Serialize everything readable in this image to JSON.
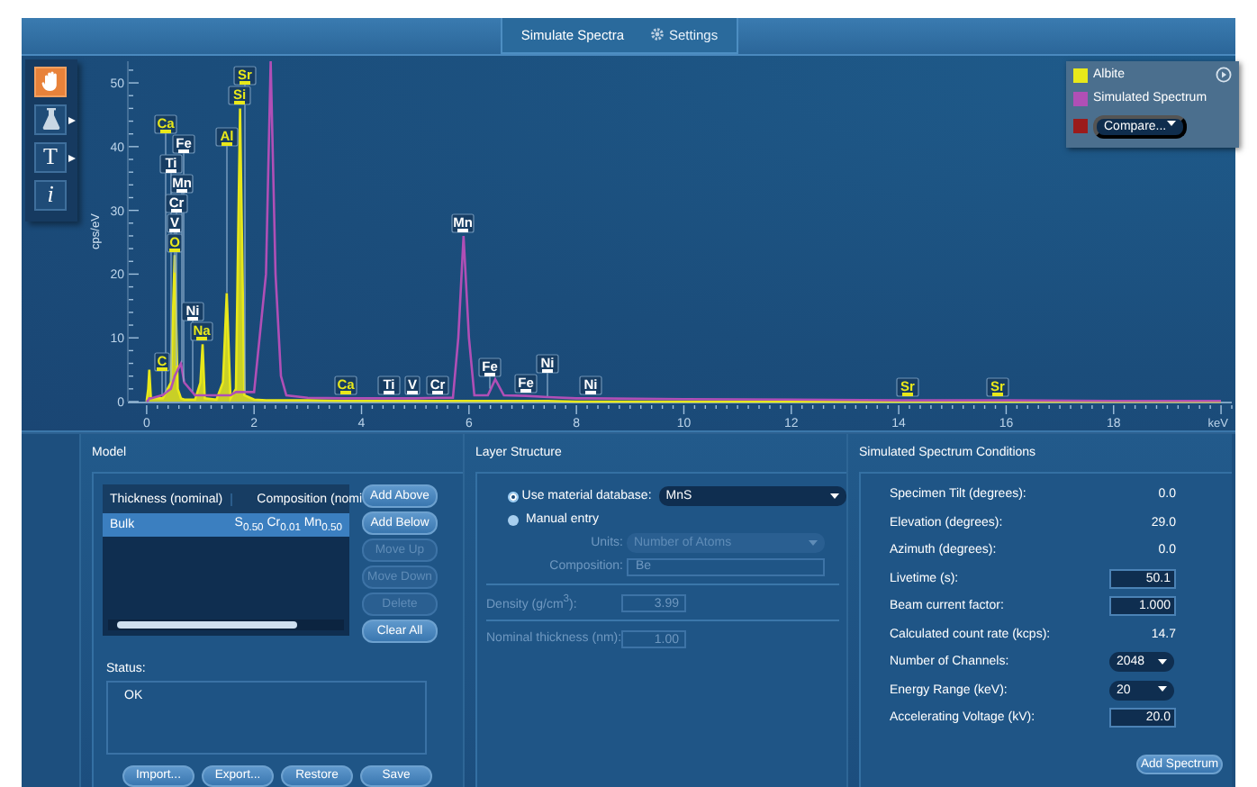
{
  "tabs": [
    {
      "label": "Simulate Spectra",
      "selected": true
    },
    {
      "label": "Settings",
      "selected": false
    }
  ],
  "toolbar": [
    {
      "kind": "hand",
      "selected": true,
      "menu": false
    },
    {
      "kind": "flask",
      "selected": false,
      "menu": true
    },
    {
      "kind": "glyph",
      "label": "T",
      "selected": false,
      "menu": true
    },
    {
      "kind": "glyph",
      "label": "i",
      "selected": false,
      "menu": false
    }
  ],
  "compare": {
    "label": "Compare...",
    "color": "#9b1b1b"
  },
  "chart_data": {
    "type": "line",
    "xlabel": "keV",
    "ylabel": "cps/eV",
    "xlim": [
      -0.35,
      20.2
    ],
    "ylim": [
      0,
      53.4
    ],
    "xticks": [
      0,
      2,
      4,
      6,
      8,
      10,
      12,
      14,
      16,
      18
    ],
    "yticks": [
      0,
      10,
      20,
      30,
      40,
      50
    ],
    "legend": "upper right",
    "x": [
      0,
      0.03,
      0.05,
      0.08,
      0.28,
      0.3,
      0.34,
      0.45,
      0.51,
      0.52,
      0.57,
      0.58,
      0.64,
      0.7,
      0.85,
      0.9,
      1.0,
      1.04,
      1.08,
      1.3,
      1.42,
      1.49,
      1.56,
      1.66,
      1.74,
      1.82,
      2.0,
      2.22,
      2.31,
      2.4,
      2.5,
      2.6,
      3,
      3.69,
      4,
      4.51,
      4.95,
      5,
      5.41,
      5.7,
      5.8,
      5.9,
      6.0,
      6.1,
      6.35,
      6.4,
      6.49,
      6.65,
      7.06,
      7.47,
      8,
      8.26,
      10,
      12,
      14,
      14.16,
      15.84,
      16,
      18,
      20
    ],
    "series": [
      {
        "name": "Albite",
        "color": "#e8e81a",
        "values": [
          0,
          2,
          5,
          0.5,
          0.5,
          0.5,
          1.2,
          3,
          20.1,
          23,
          5.5,
          2,
          0.5,
          0.3,
          0.3,
          0.3,
          3,
          9,
          0.5,
          0.3,
          3,
          17,
          0.5,
          2,
          46,
          1,
          0.3,
          0.2,
          0.2,
          0.2,
          0.2,
          0.2,
          0.2,
          0.1,
          0.1,
          0.1,
          0.1,
          0.1,
          0.1,
          0.1,
          0.1,
          0.1,
          0.1,
          0.1,
          0.1,
          0.1,
          0.1,
          0.1,
          0.1,
          0.1,
          0,
          0,
          0,
          0,
          0,
          0,
          0,
          0,
          0,
          0
        ]
      },
      {
        "name": "Simulated Spectrum",
        "color": "#b04fb6",
        "values": [
          0,
          0.2,
          0.5,
          0.5,
          1,
          1,
          1.3,
          2,
          3.7,
          4,
          4.8,
          5,
          6,
          3,
          1.5,
          1,
          1,
          1,
          1,
          1,
          1,
          1,
          1,
          1.5,
          1.5,
          1.5,
          1.5,
          20,
          53.4,
          20,
          4,
          1,
          0.6,
          0.5,
          0.5,
          0.5,
          0.5,
          0.5,
          0.6,
          0.6,
          10,
          26,
          10,
          1,
          1,
          1.9,
          3.5,
          1,
          0.9,
          0.7,
          0.5,
          0.5,
          0.4,
          0.3,
          0.2,
          0.2,
          0.2,
          0.2,
          0.1,
          0.1
        ]
      }
    ],
    "annotations": [
      {
        "text": "Si",
        "x": 1.74,
        "y": 46
      },
      {
        "text": "O",
        "x": 0.52,
        "y": 23
      },
      {
        "text": "V",
        "x": 0.51,
        "y": 20.1
      },
      {
        "text": "Al",
        "x": 1.49,
        "y": 17
      },
      {
        "text": "Na",
        "x": 1.04,
        "y": 9
      },
      {
        "text": "Cr",
        "x": 0.57,
        "y": 5.5
      },
      {
        "text": "Mn",
        "x": 0.64,
        "y": 6
      },
      {
        "text": "Ti",
        "x": 0.45,
        "y": 3
      },
      {
        "text": "Sr",
        "x": 1.82,
        "y": 1.5
      },
      {
        "text": "C",
        "x": 0.28,
        "y": 1
      },
      {
        "text": "Fe",
        "x": 0.7,
        "y": 3
      },
      {
        "text": "Ca",
        "x": 0.34,
        "y": 1.3
      },
      {
        "text": "Ni",
        "x": 0.85,
        "y": 1.5
      },
      {
        "text": "Ca",
        "x": 3.69,
        "y": 0.5
      },
      {
        "text": "Ti",
        "x": 4.51,
        "y": 0.5
      },
      {
        "text": "V",
        "x": 4.95,
        "y": 0.5
      },
      {
        "text": "Cr",
        "x": 5.41,
        "y": 0.6
      },
      {
        "text": "Mn",
        "x": 5.9,
        "y": 26
      },
      {
        "text": "Fe",
        "x": 6.4,
        "y": 1.9
      },
      {
        "text": "Fe",
        "x": 7.06,
        "y": 0.9
      },
      {
        "text": "Ni",
        "x": 7.47,
        "y": 0.7
      },
      {
        "text": "Ni",
        "x": 8.26,
        "y": 0.5
      },
      {
        "text": "Sr",
        "x": 14.16,
        "y": 0.2
      },
      {
        "text": "Sr",
        "x": 15.84,
        "y": 0.2
      }
    ]
  },
  "peak_markers": [
    {
      "color": "#e8e81a"
    },
    {
      "color": "#e8e81a"
    },
    {
      "color": "#ffffff"
    },
    {
      "color": "#e8e81a"
    },
    {
      "color": "#e8e81a"
    },
    {
      "color": "#ffffff"
    },
    {
      "color": "#ffffff"
    },
    {
      "color": "#ffffff"
    },
    {
      "color": "#e8e81a"
    },
    {
      "color": "#e8e81a"
    },
    {
      "color": "#ffffff"
    },
    {
      "color": "#e8e81a"
    },
    {
      "color": "#ffffff"
    },
    {
      "color": "#e8e81a"
    },
    {
      "color": "#ffffff"
    },
    {
      "color": "#ffffff"
    },
    {
      "color": "#ffffff"
    },
    {
      "color": "#ffffff"
    },
    {
      "color": "#ffffff"
    },
    {
      "color": "#ffffff"
    },
    {
      "color": "#ffffff"
    },
    {
      "color": "#ffffff"
    },
    {
      "color": "#e8e81a"
    },
    {
      "color": "#e8e81a"
    }
  ],
  "model": {
    "title": "Model",
    "table": {
      "columns": [
        "Thickness (nominal)",
        "Composition (nomi"
      ],
      "rows": [
        {
          "cells": [
            "Bulk",
            "S$_{0.50}$  Cr$_{0.01}$  Mn$_{0.50}$"
          ],
          "selected": true
        }
      ]
    },
    "side_buttons": [
      {
        "label": "Add Above",
        "disabled": false
      },
      {
        "label": "Add Below",
        "disabled": false
      },
      {
        "label": "Move Up",
        "disabled": true
      },
      {
        "label": "Move Down",
        "disabled": true
      },
      {
        "label": "Delete",
        "disabled": true
      },
      {
        "label": "Clear All",
        "disabled": false
      }
    ],
    "status_label": "Status:",
    "status": "OK",
    "buttons": [
      "Import...",
      "Export...",
      "Restore",
      "Save"
    ]
  },
  "layer_structure": {
    "title": "Layer Structure",
    "source": [
      {
        "label": "Use material database:",
        "selected": true
      },
      {
        "label": "Manual entry",
        "selected": false
      }
    ],
    "material": "MnS",
    "fields": [
      {
        "kind": "select",
        "label": "Units:",
        "value": "Number of Atoms",
        "disabled": true,
        "divider": false
      },
      {
        "kind": "input",
        "label": "Composition:",
        "value": "Be",
        "disabled": true,
        "divider": true
      },
      {
        "kind": "number",
        "label": "Density (g/cm$^{3}$):",
        "value": "3.99",
        "disabled": true,
        "divider": true
      },
      {
        "kind": "number",
        "label": "Nominal thickness (nm):",
        "value": "1.00",
        "disabled": true,
        "divider": false
      }
    ]
  },
  "conditions": {
    "title": "Simulated Spectrum Conditions",
    "rows": [
      {
        "kind": "text",
        "label": "Specimen Tilt (degrees):",
        "value": "0.0"
      },
      {
        "kind": "text",
        "label": "Elevation (degrees):",
        "value": "29.0"
      },
      {
        "kind": "text",
        "label": "Azimuth (degrees):",
        "value": "0.0"
      },
      {
        "kind": "input",
        "label": "Livetime (s):",
        "value": "50.1"
      },
      {
        "kind": "input",
        "label": "Beam current factor:",
        "value": "1.000"
      },
      {
        "kind": "text",
        "label": "Calculated count rate (kcps):",
        "value": "14.7"
      },
      {
        "kind": "select",
        "label": "Number of Channels:",
        "value": "2048"
      },
      {
        "kind": "select",
        "label": "Energy Range (keV):",
        "value": "20"
      },
      {
        "kind": "input",
        "label": "Accelerating Voltage (kV):",
        "value": "20.0"
      }
    ],
    "button": "Add Spectrum"
  }
}
